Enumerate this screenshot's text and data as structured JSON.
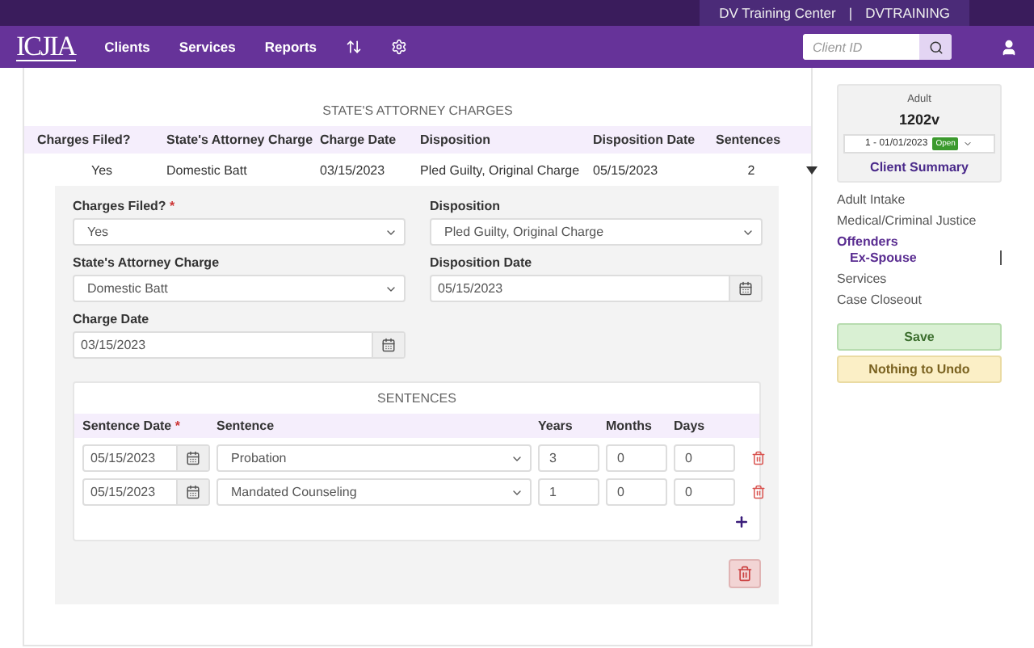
{
  "top_bar": {
    "center": "DV Training Center",
    "separator": "|",
    "account": "DVTRAINING"
  },
  "nav": {
    "logo": "ICJIA",
    "items": [
      "Clients",
      "Services",
      "Reports"
    ],
    "search": {
      "placeholder": "Client ID"
    }
  },
  "charges": {
    "title": "STATE'S ATTORNEY CHARGES",
    "columns": [
      "Charges Filed?",
      "State's Attorney Charge",
      "Charge Date",
      "Disposition",
      "Disposition Date",
      "Sentences"
    ],
    "rows": [
      {
        "cells": [
          "Yes",
          "Domestic Batt",
          "03/15/2023",
          "Pled Guilty, Original Charge",
          "05/15/2023",
          "2"
        ],
        "expanded": true
      }
    ]
  },
  "detail": {
    "fields": [
      {
        "label": "Charges Filed?",
        "required_mark": "*",
        "kind": "select",
        "value": "Yes"
      },
      {
        "label": "Disposition",
        "kind": "select",
        "value": "Pled Guilty, Original Charge"
      },
      {
        "label": "State's Attorney Charge",
        "kind": "select",
        "value": "Domestic Batt"
      },
      {
        "label": "Disposition Date",
        "kind": "date",
        "value": "05/15/2023"
      },
      {
        "label": "Charge Date",
        "kind": "date",
        "value": "03/15/2023"
      }
    ],
    "sentences": {
      "title": "SENTENCES",
      "columns": [
        {
          "label": "Sentence Date",
          "required_mark": "*"
        },
        {
          "label": "Sentence"
        },
        {
          "label": "Years"
        },
        {
          "label": "Months"
        },
        {
          "label": "Days"
        }
      ],
      "rows": [
        {
          "date": "05/15/2023",
          "sentence": "Probation",
          "years": "3",
          "months": "0",
          "days": "0"
        },
        {
          "date": "05/15/2023",
          "sentence": "Mandated Counseling",
          "years": "1",
          "months": "0",
          "days": "0"
        }
      ]
    }
  },
  "sidebar": {
    "client_type": "Adult",
    "client_id": "1202v",
    "episode": {
      "label": "1 - 01/01/2023",
      "status": "Open"
    },
    "summary_link": "Client Summary",
    "items": [
      {
        "label": "Adult Intake",
        "selected": false
      },
      {
        "label": "Medical/Criminal Justice",
        "selected": false
      },
      {
        "label": "Offenders",
        "selected": true,
        "children": [
          {
            "label": "Ex-Spouse",
            "selected": true
          }
        ]
      },
      {
        "label": "Services",
        "selected": false
      },
      {
        "label": "Case Closeout",
        "selected": false
      }
    ],
    "save": "Save",
    "undo": "Nothing to Undo"
  }
}
